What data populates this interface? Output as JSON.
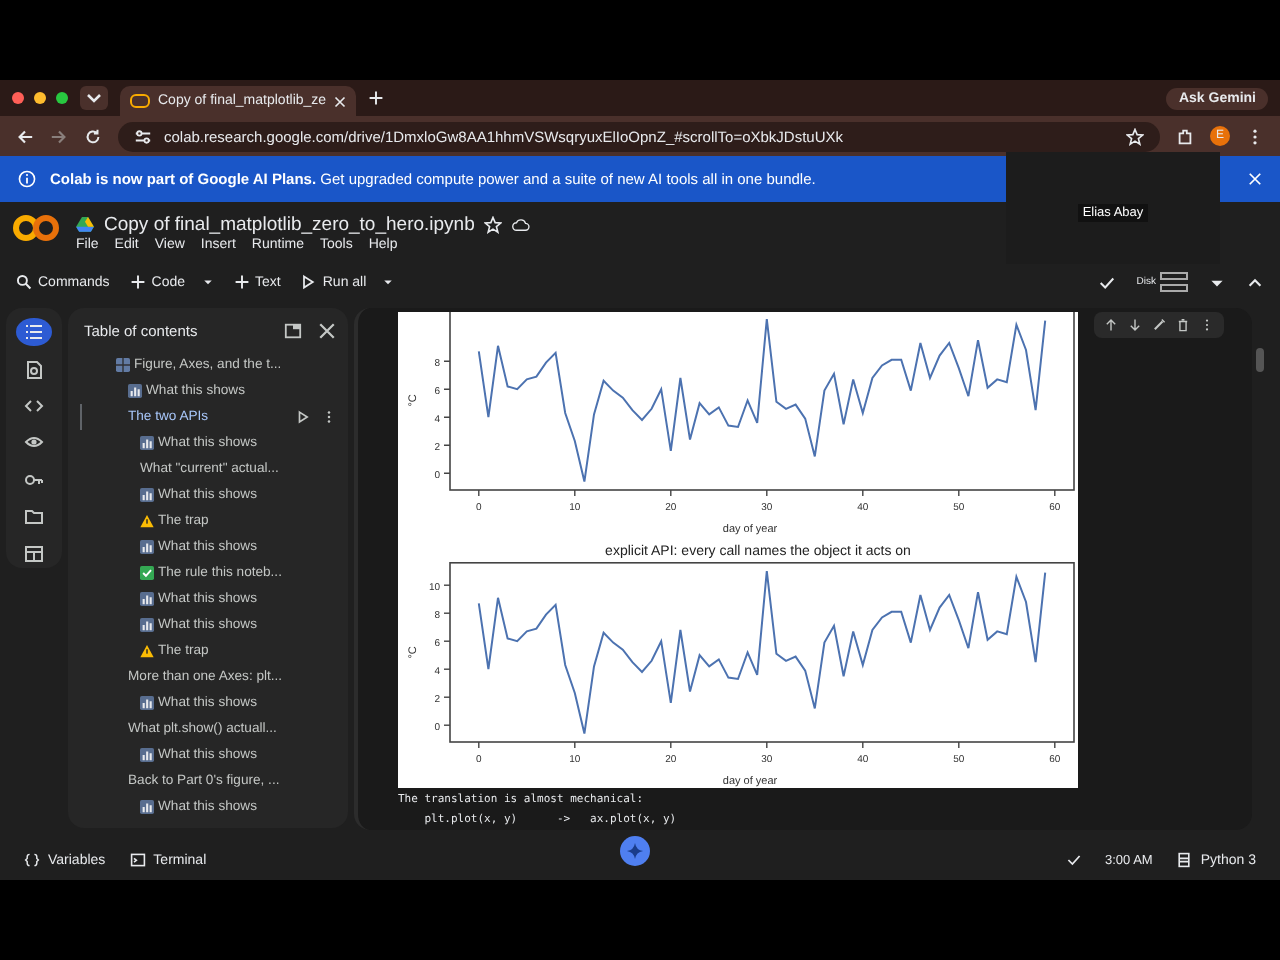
{
  "browser": {
    "tabs": [
      {
        "title": "Copy of final_matplotlib_ze",
        "selected": true
      }
    ],
    "ask_button": "Ask Gemini",
    "url": "colab.research.google.com/drive/1DmxloGw8AA1hhmVSWsqryuxElIoOpnZ_#scrollTo=oXbkJDstuUXk",
    "profile_initial": "E"
  },
  "banner": {
    "text": "**Colab is now part of Google AI Plans.** Get upgraded compute power and a suite of new AI tools all in one bundle."
  },
  "video_overlay": {
    "name": "Elias Abay"
  },
  "notebook": {
    "title": "Copy of final_matplotlib_zero_to_hero.ipynb",
    "menu": [
      "File",
      "Edit",
      "View",
      "Insert",
      "Runtime",
      "Tools",
      "Help"
    ],
    "toolbar": [
      {
        "kind": "search",
        "label": "Commands"
      },
      {
        "kind": "add-menu",
        "label": "Code"
      },
      {
        "kind": "add",
        "label": "Text"
      },
      {
        "kind": "run-menu",
        "label": "Run all"
      }
    ],
    "resources": {
      "disk": "Disk"
    }
  },
  "rail": [
    {
      "kind": "toc",
      "selected": true
    },
    {
      "kind": "find",
      "selected": false
    },
    {
      "kind": "code",
      "selected": false
    },
    {
      "kind": "variables",
      "selected": false
    },
    {
      "kind": "key",
      "selected": false
    },
    {
      "kind": "folder",
      "selected": false
    },
    {
      "kind": "table",
      "selected": false
    }
  ],
  "toc": {
    "title": "Table of contents",
    "items": [
      {
        "label": "Figure, Axes, and the t...",
        "kind": "grid",
        "selected": false,
        "children": [
          {
            "label": "What this shows",
            "kind": "chart",
            "selected": false
          },
          {
            "label": "The two APIs",
            "kind": "plain",
            "selected": true,
            "children": [
              {
                "label": "What this shows",
                "kind": "chart",
                "selected": false
              },
              {
                "label": "What \"current\" actual...",
                "kind": "plain",
                "selected": false
              },
              {
                "label": "What this shows",
                "kind": "chart",
                "selected": false
              },
              {
                "label": "The trap",
                "kind": "warning",
                "selected": false
              },
              {
                "label": "What this shows",
                "kind": "chart",
                "selected": false
              },
              {
                "label": "The rule this noteb...",
                "kind": "check",
                "selected": false
              },
              {
                "label": "What this shows",
                "kind": "chart",
                "selected": false
              },
              {
                "label": "What this shows",
                "kind": "chart",
                "selected": false
              },
              {
                "label": "The trap",
                "kind": "warning",
                "selected": false
              }
            ]
          },
          {
            "label": "More than one Axes: plt...",
            "kind": "plain",
            "selected": false,
            "children": [
              {
                "label": "What this shows",
                "kind": "chart",
                "selected": false
              }
            ]
          },
          {
            "label": "What plt.show() actuall...",
            "kind": "plain",
            "selected": false,
            "children": [
              {
                "label": "What this shows",
                "kind": "chart",
                "selected": false
              }
            ]
          },
          {
            "label": "Back to Part 0's figure, ...",
            "kind": "plain",
            "selected": false,
            "children": [
              {
                "label": "What this shows",
                "kind": "chart",
                "selected": false
              }
            ]
          }
        ]
      }
    ]
  },
  "outputs": [
    {
      "kind": "chart",
      "chart_data": {
        "type": "line",
        "xlabel": "day of year",
        "ylabel": "°C",
        "xlim": [
          -3,
          62
        ],
        "ylim": [
          -1.2,
          11.6
        ],
        "xticks": [
          0,
          10,
          20,
          30,
          40,
          50,
          60
        ],
        "yticks": [
          0,
          2,
          4,
          6,
          8
        ],
        "x": [
          0,
          1,
          2,
          3,
          4,
          5,
          6,
          7,
          8,
          9,
          10,
          11,
          12,
          13,
          14,
          15,
          16,
          17,
          18,
          19,
          20,
          21,
          22,
          23,
          24,
          25,
          26,
          27,
          28,
          29,
          30,
          31,
          32,
          33,
          34,
          35,
          36,
          37,
          38,
          39,
          40,
          41,
          42,
          43,
          44,
          45,
          46,
          47,
          48,
          49,
          50,
          51,
          52,
          53,
          54,
          55,
          56,
          57,
          58,
          59
        ],
        "series": [
          {
            "color": "#4c72b0",
            "values": [
              8.7,
              4.0,
              9.1,
              6.2,
              6.0,
              6.7,
              6.9,
              7.9,
              8.6,
              4.3,
              2.3,
              -0.6,
              4.2,
              6.6,
              5.9,
              5.4,
              4.5,
              3.8,
              4.6,
              6.0,
              1.6,
              6.8,
              2.4,
              5.0,
              4.2,
              4.7,
              3.4,
              3.3,
              5.2,
              3.6,
              11.0,
              5.1,
              4.6,
              4.9,
              3.9,
              1.2,
              5.9,
              7.1,
              3.5,
              6.7,
              4.3,
              6.8,
              7.7,
              8.1,
              8.1,
              5.9,
              9.3,
              6.8,
              8.4,
              9.3,
              7.5,
              5.5,
              9.5,
              6.1,
              6.7,
              6.5,
              10.6,
              8.8,
              4.5,
              10.9
            ]
          }
        ]
      }
    },
    {
      "kind": "chart",
      "chart_data": {
        "type": "line",
        "title": "explicit API: every call names the object it acts on",
        "xlabel": "day of year",
        "ylabel": "°C",
        "xlim": [
          -3,
          62
        ],
        "ylim": [
          -1.2,
          11.6
        ],
        "xticks": [
          0,
          10,
          20,
          30,
          40,
          50,
          60
        ],
        "yticks": [
          0,
          2,
          4,
          6,
          8,
          10
        ],
        "x": [
          0,
          1,
          2,
          3,
          4,
          5,
          6,
          7,
          8,
          9,
          10,
          11,
          12,
          13,
          14,
          15,
          16,
          17,
          18,
          19,
          20,
          21,
          22,
          23,
          24,
          25,
          26,
          27,
          28,
          29,
          30,
          31,
          32,
          33,
          34,
          35,
          36,
          37,
          38,
          39,
          40,
          41,
          42,
          43,
          44,
          45,
          46,
          47,
          48,
          49,
          50,
          51,
          52,
          53,
          54,
          55,
          56,
          57,
          58,
          59
        ],
        "series": [
          {
            "color": "#4c72b0",
            "values": [
              8.7,
              4.0,
              9.1,
              6.2,
              6.0,
              6.7,
              6.9,
              7.9,
              8.6,
              4.3,
              2.3,
              -0.6,
              4.2,
              6.6,
              5.9,
              5.4,
              4.5,
              3.8,
              4.6,
              6.0,
              1.6,
              6.8,
              2.4,
              5.0,
              4.2,
              4.7,
              3.4,
              3.3,
              5.2,
              3.6,
              11.0,
              5.1,
              4.6,
              4.9,
              3.9,
              1.2,
              5.9,
              7.1,
              3.5,
              6.7,
              4.3,
              6.8,
              7.7,
              8.1,
              8.1,
              5.9,
              9.3,
              6.8,
              8.4,
              9.3,
              7.5,
              5.5,
              9.5,
              6.1,
              6.7,
              6.5,
              10.6,
              8.8,
              4.5,
              10.9
            ]
          }
        ]
      }
    },
    {
      "kind": "text",
      "text": "The translation is almost mechanical:"
    },
    {
      "kind": "text",
      "text": "    plt.plot(x, y)      ->   ax.plot(x, y)"
    }
  ],
  "status_bar": {
    "left": [
      {
        "kind": "variables",
        "label": "Variables"
      },
      {
        "kind": "terminal",
        "label": "Terminal"
      }
    ],
    "time": "3:00 AM",
    "runtime": "Python 3"
  }
}
